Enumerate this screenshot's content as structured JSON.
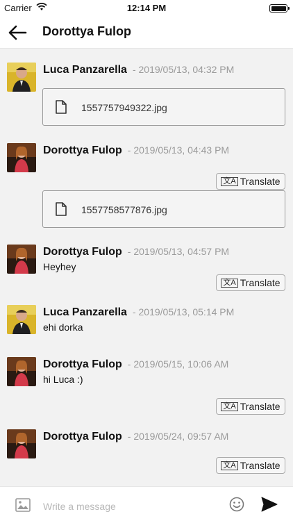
{
  "status_bar": {
    "carrier": "Carrier",
    "time": "12:14 PM"
  },
  "header": {
    "title": "Dorottya Fulop"
  },
  "messages": [
    {
      "sender": "Luca Panzarella",
      "time": "- 2019/05/13, 04:32 PM",
      "file": "1557757949322.jpg"
    },
    {
      "sender": "Dorottya Fulop",
      "time": "- 2019/05/13, 04:43 PM",
      "translate": "Translate",
      "file": "1557758577876.jpg"
    },
    {
      "sender": "Dorottya Fulop",
      "time": "- 2019/05/13, 04:57 PM",
      "text": "Heyhey",
      "translate": "Translate"
    },
    {
      "sender": "Luca Panzarella",
      "time": "- 2019/05/13, 05:14 PM",
      "text": "ehi dorka"
    },
    {
      "sender": "Dorottya Fulop",
      "time": "- 2019/05/15, 10:06 AM",
      "text": "hi Luca :)",
      "translate": "Translate"
    },
    {
      "sender": "Dorottya Fulop",
      "time": "- 2019/05/24, 09:57 AM",
      "translate": "Translate"
    }
  ],
  "composer": {
    "placeholder": "Write a message"
  },
  "colors": {
    "accent": "#111111",
    "background": "#f2f2f2",
    "timestamp": "#9a9a9a"
  }
}
